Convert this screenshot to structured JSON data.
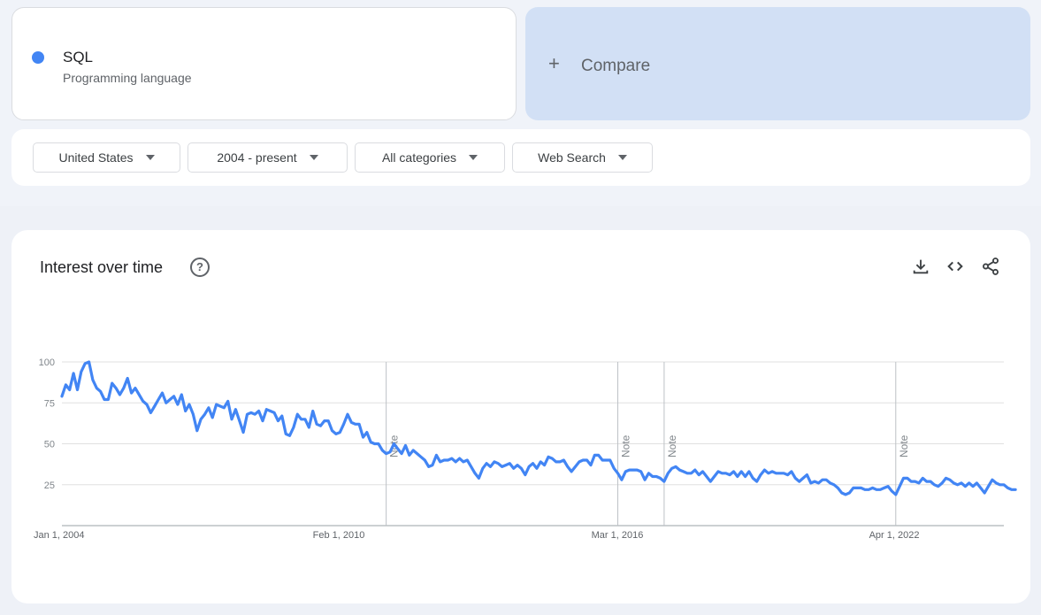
{
  "term": {
    "name": "SQL",
    "subtitle": "Programming language",
    "color": "#4285f4"
  },
  "compare": {
    "icon": "plus-icon",
    "label": "Compare"
  },
  "filters": [
    {
      "label": "United States"
    },
    {
      "label": "2004 - present"
    },
    {
      "label": "All categories"
    },
    {
      "label": "Web Search"
    }
  ],
  "chart": {
    "title": "Interest over time",
    "icons": [
      "help-icon",
      "download-icon",
      "embed-code-icon",
      "share-icon"
    ]
  },
  "chart_data": {
    "type": "line",
    "line_color": "#4285f4",
    "grid": true,
    "ylim": [
      0,
      100
    ],
    "yticks": [
      25,
      50,
      75,
      100
    ],
    "x_ticks": [
      "Jan 1, 2004",
      "Feb 1, 2010",
      "Mar 1, 2016",
      "Apr 1, 2022"
    ],
    "x_range": [
      "2004-01",
      "2024-05"
    ],
    "notes": [
      {
        "date": "2011-01",
        "label": "Note"
      },
      {
        "date": "2016-01",
        "label": "Note"
      },
      {
        "date": "2017-01",
        "label": "Note"
      },
      {
        "date": "2022-01",
        "label": "Note"
      }
    ],
    "series": [
      {
        "start": "2004-01",
        "frequency": "monthly",
        "values": [
          79,
          86,
          83,
          93,
          83,
          94,
          99,
          100,
          89,
          84,
          82,
          77,
          77,
          87,
          84,
          80,
          84,
          90,
          81,
          84,
          80,
          76,
          74,
          69,
          73,
          77,
          81,
          75,
          77,
          79,
          74,
          80,
          70,
          74,
          68,
          58,
          65,
          68,
          72,
          66,
          74,
          73,
          72,
          76,
          65,
          71,
          64,
          57,
          68,
          69,
          68,
          70,
          64,
          71,
          70,
          69,
          64,
          67,
          56,
          55,
          60,
          68,
          65,
          65,
          60,
          70,
          62,
          61,
          64,
          64,
          58,
          56,
          57,
          62,
          68,
          63,
          62,
          62,
          54,
          57,
          51,
          50,
          50,
          46,
          44,
          45,
          50,
          47,
          44,
          49,
          43,
          46,
          44,
          42,
          40,
          36,
          37,
          43,
          39,
          40,
          40,
          41,
          39,
          41,
          39,
          40,
          36,
          32,
          29,
          35,
          38,
          36,
          39,
          38,
          36,
          37,
          38,
          35,
          37,
          35,
          31,
          36,
          38,
          35,
          39,
          37,
          42,
          41,
          39,
          39,
          40,
          36,
          33,
          36,
          39,
          40,
          40,
          37,
          43,
          43,
          40,
          40,
          40,
          35,
          32,
          28,
          33,
          34,
          34,
          34,
          33,
          28,
          32,
          30,
          30,
          29,
          27,
          32,
          35,
          36,
          34,
          33,
          32,
          32,
          34,
          31,
          33,
          30,
          27,
          30,
          33,
          32,
          32,
          31,
          33,
          30,
          33,
          30,
          33,
          29,
          27,
          31,
          34,
          32,
          33,
          32,
          32,
          32,
          31,
          33,
          29,
          27,
          29,
          31,
          26,
          27,
          26,
          28,
          28,
          26,
          25,
          23,
          20,
          19,
          20,
          23,
          23,
          23,
          22,
          22,
          23,
          22,
          22,
          23,
          24,
          21,
          19,
          24,
          29,
          29,
          27,
          27,
          26,
          29,
          27,
          27,
          25,
          24,
          26,
          29,
          28,
          26,
          25,
          26,
          24,
          26,
          24,
          26,
          23,
          20,
          24,
          28,
          26,
          25,
          25,
          23,
          22,
          22
        ]
      }
    ]
  }
}
